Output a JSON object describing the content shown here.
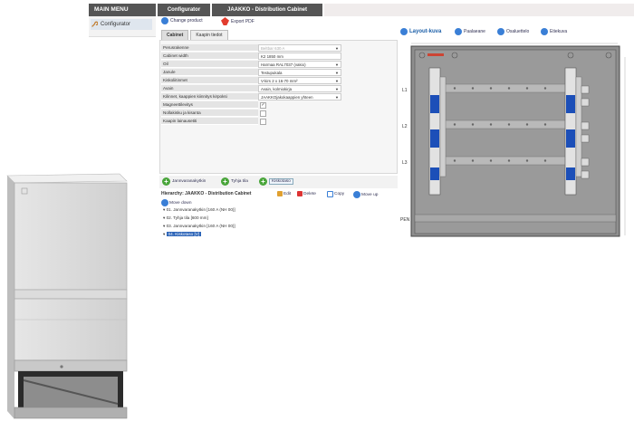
{
  "nav": {
    "main_menu": "MAIN MENU",
    "configurator": "Configurator"
  },
  "tabs": {
    "configurator": "Configurator",
    "jaakko": "JAAKKO - Distribution Cabinet"
  },
  "toolbar": {
    "change_product": "Change product",
    "export_pdf": "Export PDF"
  },
  "config": {
    "tabs": [
      "Cabinet",
      "Kaapin tiedot"
    ],
    "properties": [
      {
        "label": "Perusrakenne",
        "value": "Beltbar 630 A",
        "type": "select",
        "disabled": true
      },
      {
        "label": "Cabinet width",
        "value": "K2 1850 mm",
        "type": "text"
      },
      {
        "label": "Oil",
        "value": "Harmaa RAL7037 (vakio)",
        "type": "select"
      },
      {
        "label": "Janule",
        "value": "Testupukala",
        "type": "select"
      },
      {
        "label": "Kiskoliitinmet",
        "value": "V-kirs 2 x 16-70 mm²",
        "type": "select"
      },
      {
        "label": "Avain",
        "value": "Avain, kolmiokirja",
        "type": "select"
      },
      {
        "label": "Kilinnet, kaappien kiinnitys kirpoksi",
        "value": "JAAKKOjakokaappien yhteen",
        "type": "select"
      },
      {
        "label": "Magneettilevitys",
        "value": "✓",
        "type": "check"
      },
      {
        "label": "Nollakisku ja kisanta",
        "value": "",
        "type": "check"
      },
      {
        "label": "Kaapin lainausetiti",
        "value": "",
        "type": "check"
      }
    ]
  },
  "modules": {
    "buttons": [
      "Jannvaranakytkin",
      "Tyhja tila",
      "Kiskotaso"
    ]
  },
  "tree": {
    "title": "Hierarchy: JAAKKO - Distribution Cabinet",
    "actions": [
      "Edit",
      "Delete",
      "Copy",
      "Move up"
    ],
    "move_down": "Move down",
    "items": [
      "01. Jannvaranakytkin [160 A (NH 00)]",
      "02. Tyhja tila [600 mm]",
      "03. Jannvaranakytkin [160 A (NH 00)]",
      "04. Kiskotaso [V]"
    ]
  },
  "layout": {
    "title": "Layout-kuva",
    "views": [
      "Paalaeane",
      "Osaluettelo",
      "Etiekuva"
    ],
    "rows": [
      "L1",
      "L2",
      "L3",
      "PEN"
    ]
  },
  "colors": {
    "nav_dark": "#555555",
    "accent_blue": "#3a7fd6",
    "add_green": "#49a53a",
    "pdf_red": "#e23c2e",
    "busbar_blue": "#1c4fb8",
    "drawing_plate": "#909090"
  }
}
